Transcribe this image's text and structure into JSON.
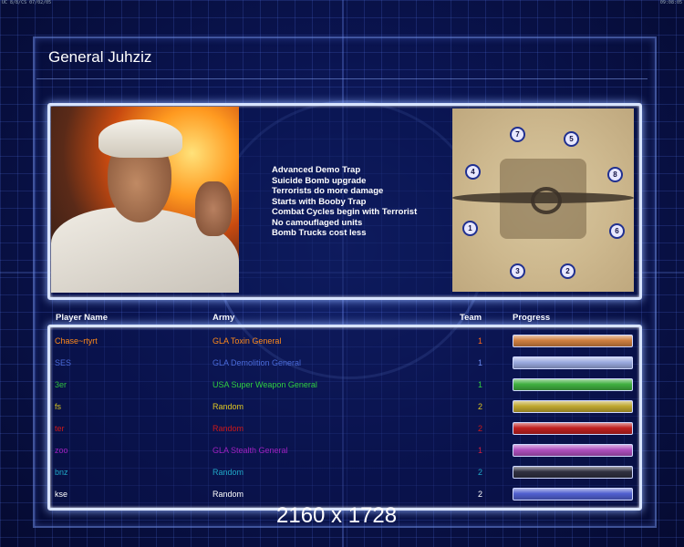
{
  "status": {
    "left": "UC 8/8/CS 07/02/05",
    "right": "09:08:05"
  },
  "title": "General Juhziz",
  "traits": [
    "Advanced Demo Trap",
    "Suicide Bomb upgrade",
    "Terrorists do more damage",
    "Starts with Booby Trap",
    "Combat Cycles begin with Terrorist",
    "No camouflaged units",
    "Bomb Trucks cost less"
  ],
  "map_spots": [
    "7",
    "5",
    "4",
    "8",
    "1",
    "6",
    "3",
    "2"
  ],
  "columns": {
    "name": "Player Name",
    "army": "Army",
    "team": "Team",
    "progress": "Progress"
  },
  "players": [
    {
      "name": "Chase~rtyrt",
      "army": "GLA Toxin General",
      "team": "1",
      "name_color": "#ff8a1a",
      "army_color": "#ff8a1a",
      "team_color": "#ff6a1a",
      "bar_color": "#d08040",
      "progress": 1.0
    },
    {
      "name": "SES",
      "army": "GLA Demolition General",
      "team": "1",
      "name_color": "#4a6ad8",
      "army_color": "#4a6ad8",
      "team_color": "#6a8af0",
      "bar_color": "#9aaae0",
      "progress": 1.0
    },
    {
      "name": "3er",
      "army": "USA Super Weapon General",
      "team": "1",
      "name_color": "#30c040",
      "army_color": "#30d040",
      "team_color": "#30d040",
      "bar_color": "#40b040",
      "progress": 1.0
    },
    {
      "name": "fs",
      "army": "Random",
      "team": "2",
      "name_color": "#d8c420",
      "army_color": "#e0c820",
      "team_color": "#e0c820",
      "bar_color": "#c0a830",
      "progress": 1.0
    },
    {
      "name": "ter",
      "army": "Random",
      "team": "2",
      "name_color": "#d01818",
      "army_color": "#d01818",
      "team_color": "#d01818",
      "bar_color": "#c02020",
      "progress": 1.0
    },
    {
      "name": "zoo",
      "army": "GLA Stealth General",
      "team": "1",
      "name_color": "#a020c0",
      "army_color": "#a020c0",
      "team_color": "#d02040",
      "bar_color": "#b050c0",
      "progress": 1.0
    },
    {
      "name": "bnz",
      "army": "Random",
      "team": "2",
      "name_color": "#20a8c8",
      "army_color": "#20a8c8",
      "team_color": "#20a8c8",
      "bar_color": "#303040",
      "progress": 1.0
    },
    {
      "name": "kse",
      "army": "Random",
      "team": "2",
      "name_color": "#ffffff",
      "army_color": "#ffffff",
      "team_color": "#ffffff",
      "bar_color": "#5060d0",
      "progress": 1.0
    }
  ],
  "resolution": "2160 x 1728"
}
